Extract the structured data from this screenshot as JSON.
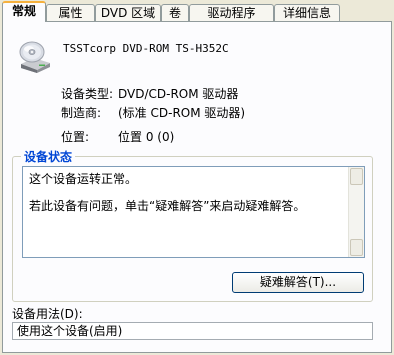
{
  "tabs": [
    {
      "label": "常规"
    },
    {
      "label": "属性"
    },
    {
      "label": "DVD 区域"
    },
    {
      "label": "卷"
    },
    {
      "label": "驱动程序"
    },
    {
      "label": "详细信息"
    }
  ],
  "device": {
    "name": "TSSTcorp DVD-ROM TS-H352C",
    "icon": "cd-drive-icon"
  },
  "info": [
    {
      "label": "设备类型:",
      "value": "DVD/CD-ROM 驱动器"
    },
    {
      "label": "制造商:",
      "value": "(标准 CD-ROM 驱动器)"
    },
    {
      "label": "位置:",
      "value": "位置 0 (0)"
    }
  ],
  "status_group": {
    "title": "设备状态",
    "line1": "这个设备运转正常。",
    "line2": "若此设备有问题，单击“疑难解答”来启动疑难解答。",
    "button_label": "疑难解答(T)..."
  },
  "usage": {
    "label": "设备用法(D):",
    "value": "使用这个设备(启用)"
  }
}
